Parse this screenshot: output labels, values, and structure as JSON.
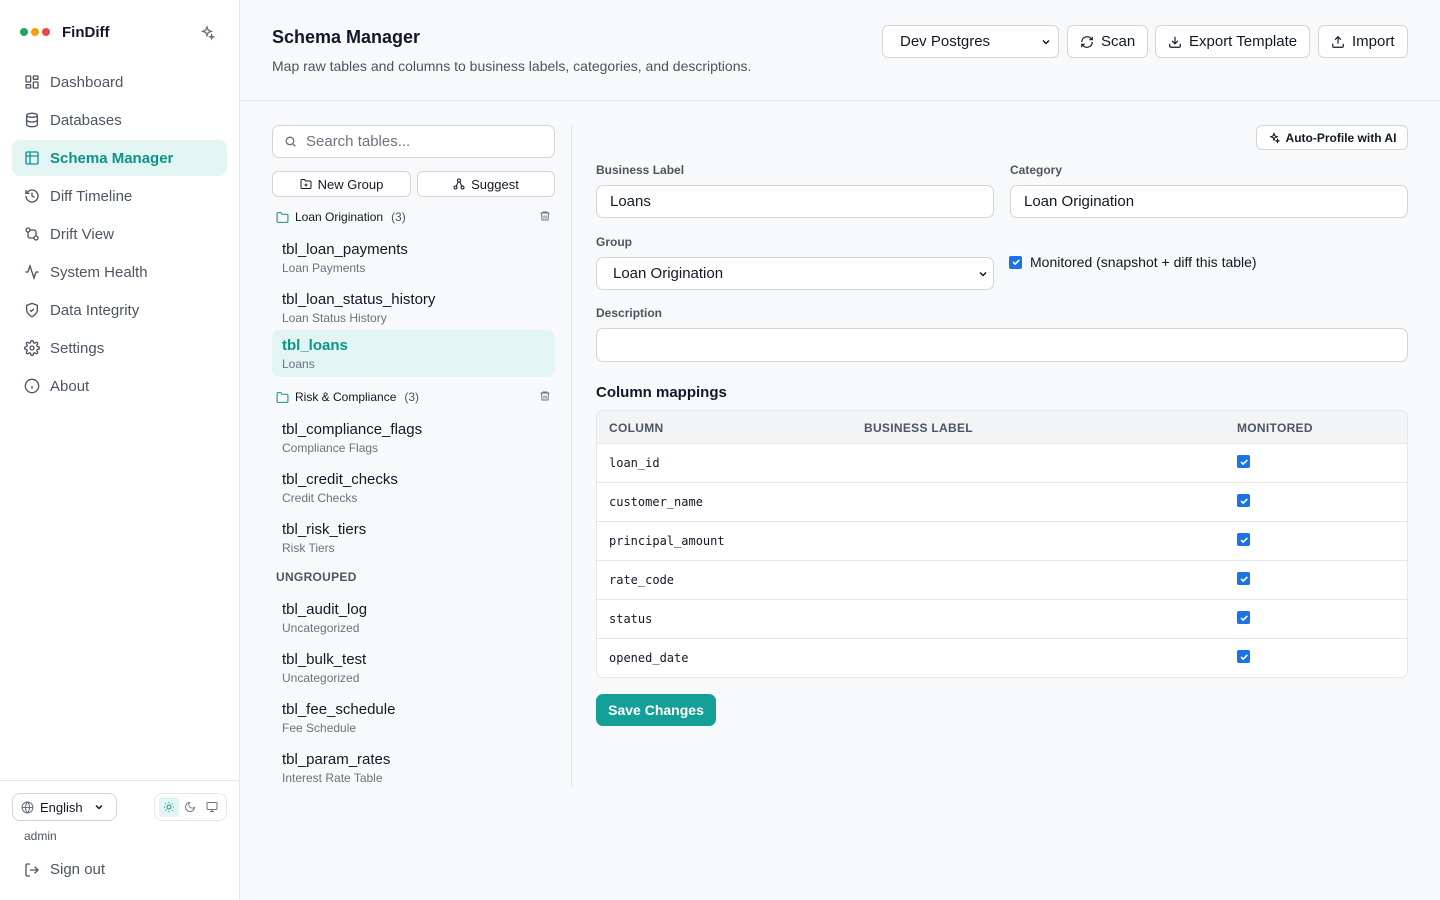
{
  "app": {
    "name": "FinDiff",
    "dot_colors": [
      "#22a55b",
      "#f59e0b",
      "#ef4444"
    ]
  },
  "sidebar": {
    "items": [
      {
        "label": "Dashboard",
        "icon": "dashboard-icon"
      },
      {
        "label": "Databases",
        "icon": "database-icon"
      },
      {
        "label": "Schema Manager",
        "icon": "table-icon",
        "active": true
      },
      {
        "label": "Diff Timeline",
        "icon": "history-icon"
      },
      {
        "label": "Drift View",
        "icon": "git-compare-icon"
      },
      {
        "label": "System Health",
        "icon": "activity-icon"
      },
      {
        "label": "Data Integrity",
        "icon": "shield-icon"
      },
      {
        "label": "Settings",
        "icon": "gear-icon"
      },
      {
        "label": "About",
        "icon": "info-icon"
      }
    ],
    "language": "English",
    "user": "admin",
    "sign_out": "Sign out"
  },
  "header": {
    "title": "Schema Manager",
    "subtitle": "Map raw tables and columns to business labels, categories, and descriptions.",
    "database": "Dev Postgres",
    "scan_label": "Scan",
    "export_label": "Export Template",
    "import_label": "Import"
  },
  "tables_panel": {
    "search_placeholder": "Search tables...",
    "new_group_label": "New Group",
    "suggest_label": "Suggest",
    "groups": [
      {
        "name": "Loan Origination",
        "count": "(3)",
        "tables": [
          {
            "name": "tbl_loan_payments",
            "label": "Loan Payments"
          },
          {
            "name": "tbl_loan_status_history",
            "label": "Loan Status History"
          },
          {
            "name": "tbl_loans",
            "label": "Loans",
            "active": true
          }
        ]
      },
      {
        "name": "Risk & Compliance",
        "count": "(3)",
        "tables": [
          {
            "name": "tbl_compliance_flags",
            "label": "Compliance Flags"
          },
          {
            "name": "tbl_credit_checks",
            "label": "Credit Checks"
          },
          {
            "name": "tbl_risk_tiers",
            "label": "Risk Tiers"
          }
        ]
      }
    ],
    "ungrouped_label": "UNGROUPED",
    "ungrouped": [
      {
        "name": "tbl_audit_log",
        "label": "Uncategorized"
      },
      {
        "name": "tbl_bulk_test",
        "label": "Uncategorized"
      },
      {
        "name": "tbl_fee_schedule",
        "label": "Fee Schedule"
      },
      {
        "name": "tbl_param_rates",
        "label": "Interest Rate Table"
      }
    ]
  },
  "editor": {
    "auto_profile_label": "Auto-Profile with AI",
    "business_label_title": "Business Label",
    "business_label_value": "Loans",
    "category_title": "Category",
    "category_value": "Loan Origination",
    "group_title": "Group",
    "group_value": "Loan Origination",
    "monitored_label": "Monitored (snapshot + diff this table)",
    "monitored": true,
    "description_title": "Description",
    "description_value": "",
    "column_mappings_title": "Column mappings",
    "columns_header": [
      "COLUMN",
      "BUSINESS LABEL",
      "MONITORED"
    ],
    "columns": [
      {
        "name": "loan_id",
        "label": "",
        "monitored": true
      },
      {
        "name": "customer_name",
        "label": "",
        "monitored": true
      },
      {
        "name": "principal_amount",
        "label": "",
        "monitored": true
      },
      {
        "name": "rate_code",
        "label": "",
        "monitored": true
      },
      {
        "name": "status",
        "label": "",
        "monitored": true
      },
      {
        "name": "opened_date",
        "label": "",
        "monitored": true
      }
    ],
    "save_label": "Save Changes"
  },
  "colors": {
    "accent": "#0d9488",
    "accent_bg": "#e2f5f3",
    "save_button": "#14a097",
    "checkbox": "#1a73e8"
  }
}
